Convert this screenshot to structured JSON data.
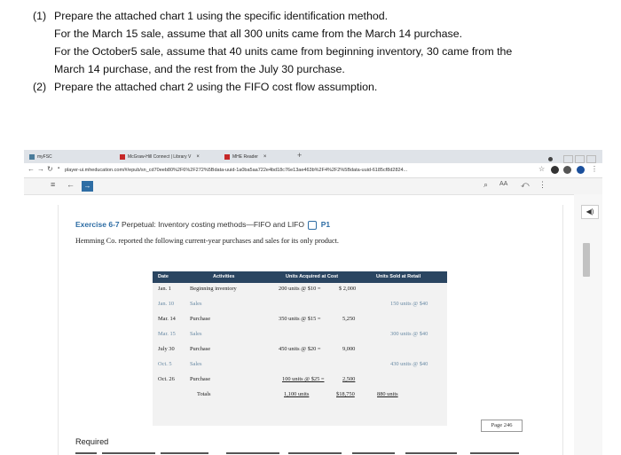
{
  "instructions": [
    {
      "num": "(1)",
      "lines": [
        "Prepare the attached chart 1 using the specific identification method.",
        "For the March 15 sale, assume that all 300 units came from the March 14 purchase.",
        "For the October5 sale, assume that 40 units came from beginning inventory, 30 came from the",
        "March 14 purchase, and the rest from the July 30 purchase."
      ]
    },
    {
      "num": "(2)",
      "lines": [
        "Prepare the attached chart 2 using the FIFO cost flow assumption."
      ]
    }
  ],
  "browser": {
    "tabs": [
      {
        "label": "myFSC",
        "fav": "g"
      },
      {
        "label": "McGraw-Hill Connect | Library V",
        "fav": "r"
      },
      {
        "label": "MHE Reader",
        "fav": "r"
      }
    ],
    "url": "player-ui.mheducation.com/#/epub/sn_cd70eeb80%2F6%2F272%5Bdata-uuid-1a0ba5aa722e4bd18c76e13ae463b%2F4%2F2%5Bdata-uuid-6185cf8d2824..."
  },
  "exercise": {
    "code": "Exercise 6-7",
    "title": "Perpetual: Inventory costing methods—FIFO and LIFO",
    "badge": "P1",
    "intro": "Hemming Co. reported the following current-year purchases and sales for its only product."
  },
  "table": {
    "headers": [
      "Date",
      "Activities",
      "Units Acquired at Cost",
      "Units Sold at Retail"
    ],
    "rows": [
      {
        "date": "Jan.  1",
        "activity": "Beginning inventory",
        "acquired": "200 units @ $10 =",
        "amount": "$ 2,000",
        "sold": "",
        "muted": false
      },
      {
        "date": "Jan. 10",
        "activity": "Sales",
        "acquired": "",
        "amount": "",
        "sold": "150 units @ $40",
        "muted": true
      },
      {
        "date": "Mar. 14",
        "activity": "Purchase",
        "acquired": "350 units @ $15 =",
        "amount": "5,250",
        "sold": "",
        "muted": false
      },
      {
        "date": "Mar. 15",
        "activity": "Sales",
        "acquired": "",
        "amount": "",
        "sold": "300 units @ $40",
        "muted": true
      },
      {
        "date": "July 30",
        "activity": "Purchase",
        "acquired": "450 units @ $20 =",
        "amount": "9,000",
        "sold": "",
        "muted": false
      },
      {
        "date": "Oct.  5",
        "activity": "Sales",
        "acquired": "",
        "amount": "",
        "sold": "430 units @ $40",
        "muted": true
      },
      {
        "date": "Oct. 26",
        "activity": "Purchase",
        "acquired": "100 units @ $25 =",
        "amount": "2,500",
        "sold": "",
        "muted": false
      },
      {
        "date": "",
        "activity": "Totals",
        "acquired": "1,100 units",
        "amount": "$18,750",
        "sold": "880 units",
        "muted": false
      }
    ]
  },
  "page_label": "Page 246",
  "required_label": "Required"
}
